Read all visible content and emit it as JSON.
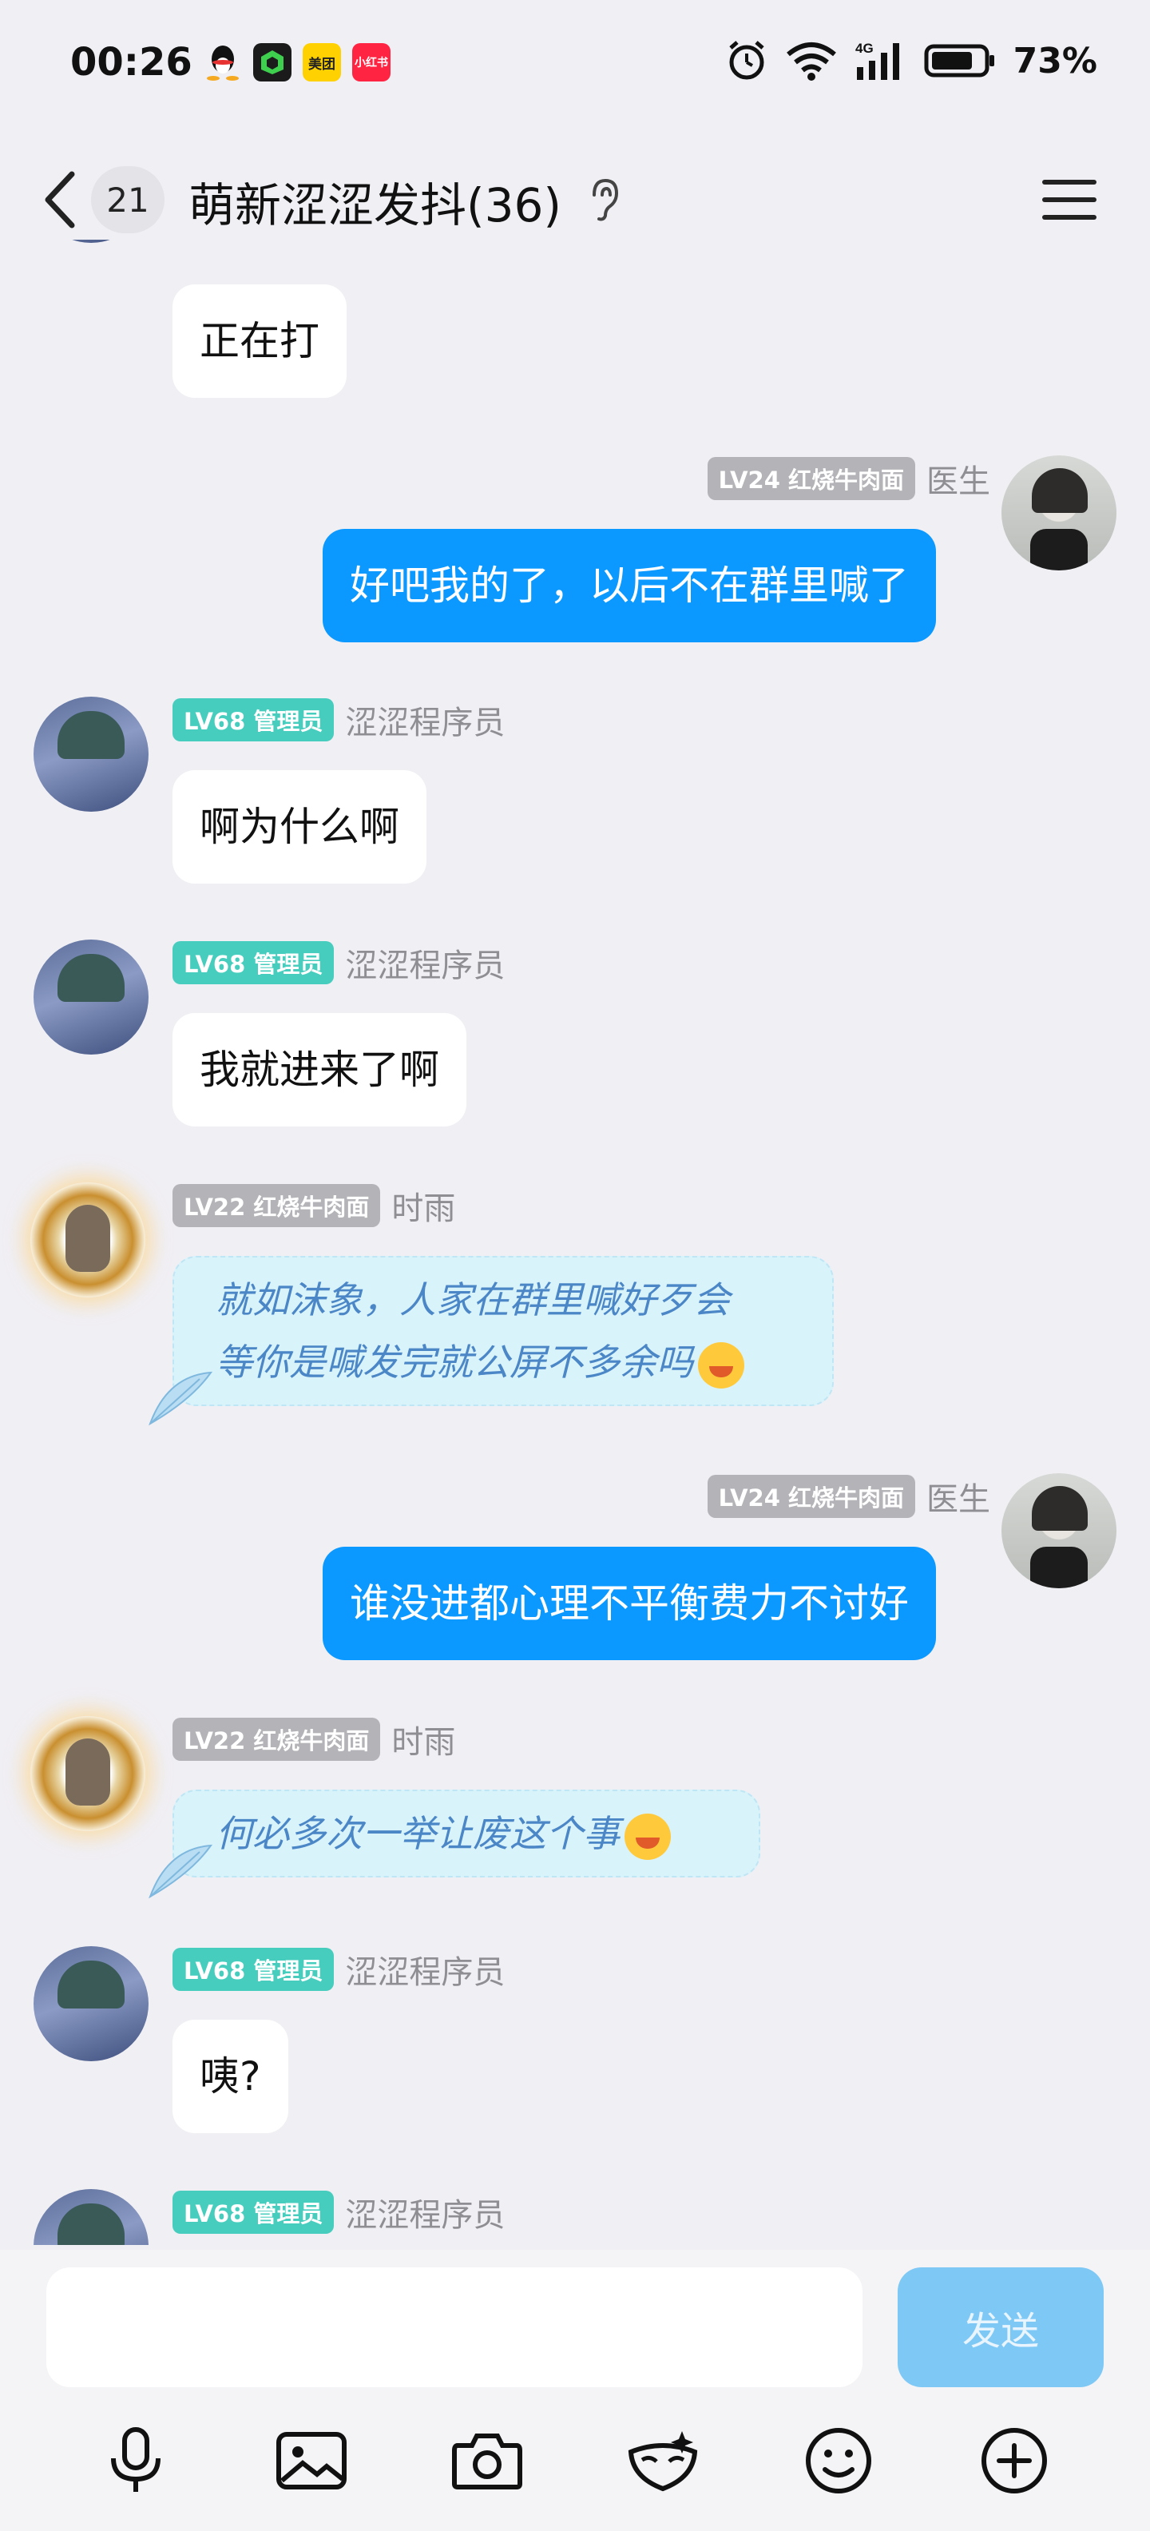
{
  "status_bar": {
    "time": "00:26",
    "apps": [
      "QQ",
      "",
      "美团",
      "小红书"
    ],
    "battery": "73%",
    "network": "4G"
  },
  "header": {
    "unread_count": "21",
    "title": "萌新涩涩发抖(36)"
  },
  "messages": [
    {
      "side": "left",
      "avatar": "admin-avatar",
      "text": "正在打"
    },
    {
      "side": "right",
      "tag": "LV24 红烧牛肉面",
      "sender": "医生",
      "text": "好吧我的了，以后不在群里喊了"
    },
    {
      "side": "left",
      "tag": "LV68 管理员",
      "sender": "涩涩程序员",
      "text": "啊为什么啊"
    },
    {
      "side": "left",
      "tag": "LV68 管理员",
      "sender": "涩涩程序员",
      "text": "我就进来了啊"
    },
    {
      "side": "left",
      "tag": "LV22 红烧牛肉面",
      "sender": "时雨",
      "line1": "就如沫象，人家在群里喊好歹会",
      "line2": "等你是喊发完就公屏不多余吗"
    },
    {
      "side": "right",
      "tag": "LV24 红烧牛肉面",
      "sender": "医生",
      "text": "谁没进都心理不平衡费力不讨好"
    },
    {
      "side": "left",
      "tag": "LV22 红烧牛肉面",
      "sender": "时雨",
      "text": "何必多次一举让废这个事"
    },
    {
      "side": "left",
      "tag": "LV68 管理员",
      "sender": "涩涩程序员",
      "text": "咦?"
    },
    {
      "side": "left",
      "tag": "LV68 管理员",
      "sender": "涩涩程序员"
    }
  ],
  "input": {
    "placeholder": "",
    "send_label": "发送"
  },
  "toolbar": [
    "mic-icon",
    "image-icon",
    "camera-icon",
    "mask-icon",
    "emoji-icon",
    "plus-icon"
  ],
  "colors": {
    "accent_blue": "#0b99ff",
    "admin_tag": "#46cdbd",
    "gray_tag": "#b4b4b8",
    "send_button": "#7ec8f6"
  }
}
